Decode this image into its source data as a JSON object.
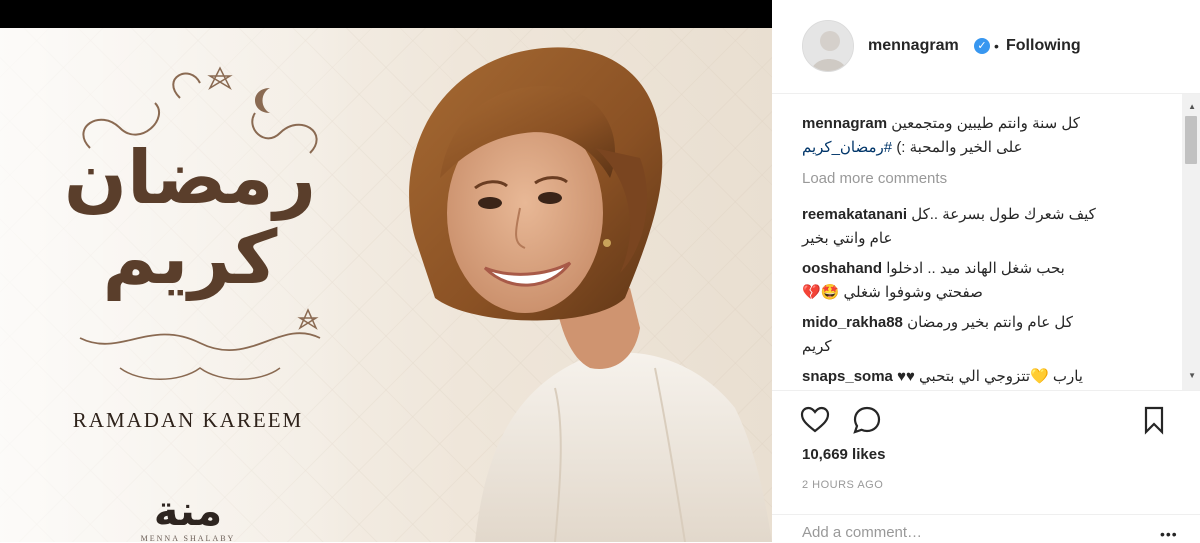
{
  "post": {
    "image_title_ar": "رمضان كريم",
    "image_title_en": "RAMADAN KAREEM",
    "brand_mark": "منة",
    "brand_name": "MENNA SHALABY"
  },
  "header": {
    "username": "mennagram",
    "separator": "•",
    "follow_status": "Following"
  },
  "caption": {
    "username": "mennagram",
    "line1": "كل سنة وانتم طيبين ومتجمعين",
    "line2_text": "على الخير والمحبة :)",
    "hashtag": "#رمضان_كريم"
  },
  "load_more": "Load more comments",
  "comments": [
    {
      "username": "reemakatanani",
      "line1": "كيف شعرك طول بسرعة ..كل",
      "line2": "عام وانتي بخير"
    },
    {
      "username": "ooshahand",
      "line1": "بحب شغل الهاند ميد .. ادخلوا",
      "line2": "صفحتي وشوفوا شغلي 🤩💔"
    },
    {
      "username": "mido_rakha88",
      "line1": "كل عام وانتم بخير ورمضان",
      "line2": "كريم"
    },
    {
      "username": "snaps_soma",
      "line1": "يارب 💛تتزوجي الي بتحبي ♥♥",
      "line2": ""
    }
  ],
  "likes": "10,669 likes",
  "time_ago": "2 HOURS AGO",
  "add_comment_placeholder": "Add a comment…",
  "more_options": "•••",
  "icons": {
    "like": "heart-icon",
    "comment": "comment-icon",
    "save": "bookmark-icon",
    "verified": "verified-badge-icon"
  },
  "colors": {
    "verified": "#3897f0",
    "hashtag": "#003569",
    "muted": "#999999",
    "brown": "#5a3e2b"
  }
}
